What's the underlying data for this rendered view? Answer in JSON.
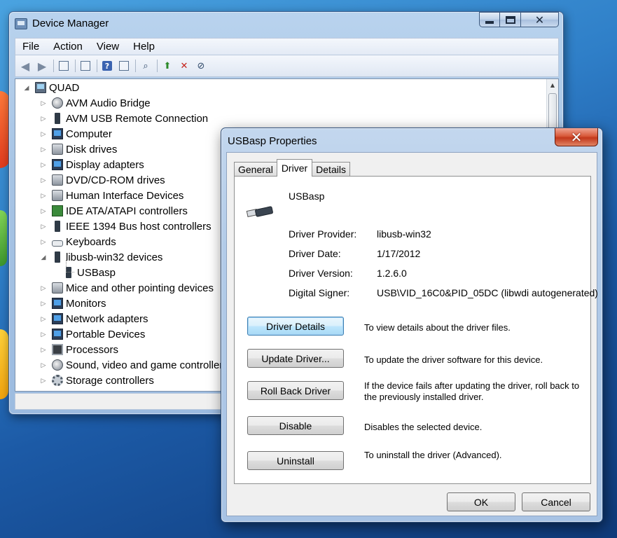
{
  "device_manager": {
    "title": "Device Manager",
    "menu": [
      "File",
      "Action",
      "View",
      "Help"
    ],
    "toolbar_icons": [
      "back-arrow-icon",
      "forward-arrow-icon",
      "show-hide-tree-icon",
      "properties-icon",
      "help-icon",
      "view-icon",
      "scan-hardware-icon",
      "update-driver-icon",
      "uninstall-icon",
      "disable-icon"
    ],
    "tree": {
      "root": "QUAD",
      "items": [
        {
          "label": "AVM Audio Bridge",
          "icon": "audio-icon"
        },
        {
          "label": "AVM USB Remote Connection",
          "icon": "usb-plug-icon"
        },
        {
          "label": "Computer",
          "icon": "computer-icon"
        },
        {
          "label": "Disk drives",
          "icon": "disk-drive-icon"
        },
        {
          "label": "Display adapters",
          "icon": "display-adapter-icon"
        },
        {
          "label": "DVD/CD-ROM drives",
          "icon": "dvd-drive-icon"
        },
        {
          "label": "Human Interface Devices",
          "icon": "hid-icon"
        },
        {
          "label": "IDE ATA/ATAPI controllers",
          "icon": "ide-controller-icon"
        },
        {
          "label": "IEEE 1394 Bus host controllers",
          "icon": "ieee1394-icon"
        },
        {
          "label": "Keyboards",
          "icon": "keyboard-icon"
        },
        {
          "label": "libusb-win32 devices",
          "icon": "usb-plug-icon",
          "expanded": true
        },
        {
          "label": "USBasp",
          "icon": "usb-plug-icon",
          "child": true
        },
        {
          "label": "Mice and other pointing devices",
          "icon": "mouse-icon"
        },
        {
          "label": "Monitors",
          "icon": "monitor-icon"
        },
        {
          "label": "Network adapters",
          "icon": "network-adapter-icon"
        },
        {
          "label": "Portable Devices",
          "icon": "portable-device-icon"
        },
        {
          "label": "Processors",
          "icon": "processor-icon"
        },
        {
          "label": "Sound, video and game controllers",
          "icon": "sound-icon"
        },
        {
          "label": "Storage controllers",
          "icon": "storage-controller-icon"
        }
      ]
    }
  },
  "properties": {
    "title": "USBasp Properties",
    "tabs": [
      "General",
      "Driver",
      "Details"
    ],
    "active_tab": "Driver",
    "device_name": "USBasp",
    "info": [
      {
        "label": "Driver Provider:",
        "value": "libusb-win32"
      },
      {
        "label": "Driver Date:",
        "value": "1/17/2012"
      },
      {
        "label": "Driver Version:",
        "value": "1.2.6.0"
      },
      {
        "label": "Digital Signer:",
        "value": "USB\\VID_16C0&PID_05DC (libwdi autogenerated)"
      }
    ],
    "actions": [
      {
        "label": "Driver Details",
        "desc": "To view details about the driver files."
      },
      {
        "label": "Update Driver...",
        "desc": "To update the driver software for this device."
      },
      {
        "label": "Roll Back Driver",
        "desc": "If the device fails after updating the driver, roll back to the previously installed driver."
      },
      {
        "label": "Disable",
        "desc": "Disables the selected device."
      },
      {
        "label": "Uninstall",
        "desc": "To uninstall the driver (Advanced)."
      }
    ],
    "ok_label": "OK",
    "cancel_label": "Cancel"
  }
}
